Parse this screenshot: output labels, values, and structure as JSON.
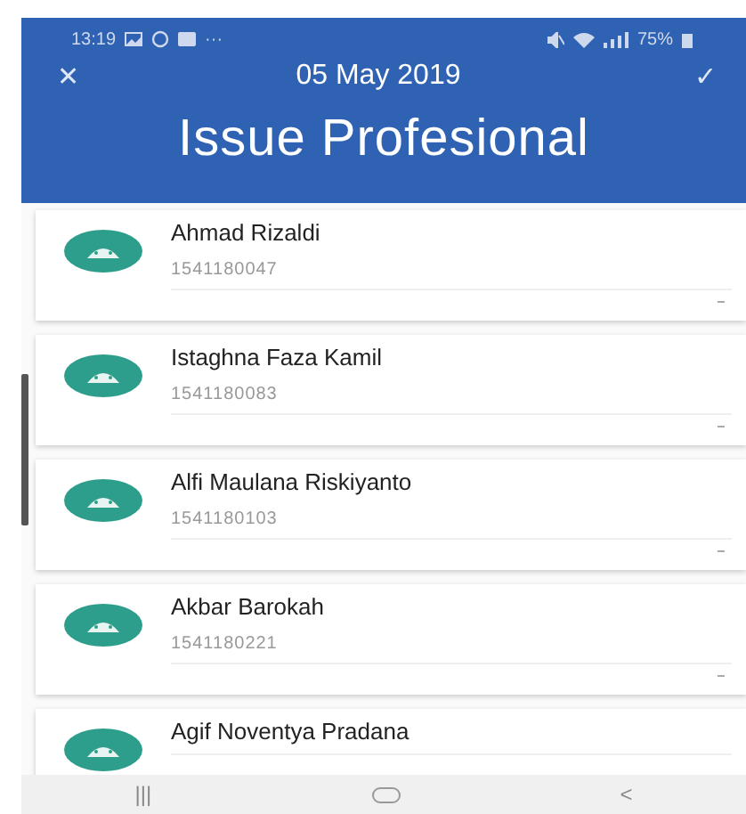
{
  "status_bar": {
    "time": "13:19",
    "dots": "···",
    "battery": "75%"
  },
  "toolbar": {
    "close": "✕",
    "date": "05 May 2019",
    "confirm": "✓"
  },
  "title": "Issue Profesional",
  "students": [
    {
      "name": "Ahmad Rizaldi",
      "number": "1541180047"
    },
    {
      "name": "Istaghna Faza Kamil",
      "number": "1541180083"
    },
    {
      "name": "Alfi Maulana Riskiyanto",
      "number": "1541180103"
    },
    {
      "name": "Akbar Barokah",
      "number": "1541180221"
    },
    {
      "name": "Agif Noventya Pradana"
    }
  ],
  "nav_bar": {
    "recents": "|||",
    "back": "<"
  }
}
